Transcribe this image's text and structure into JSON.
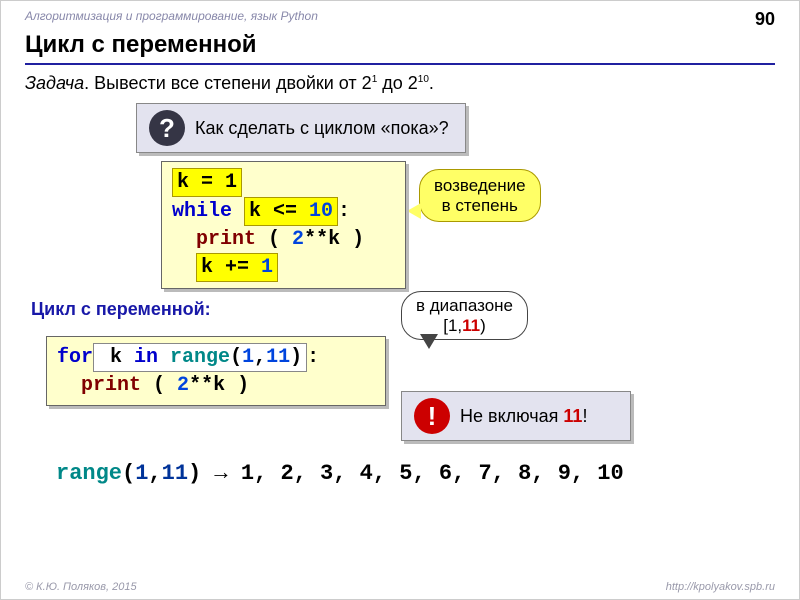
{
  "meta": {
    "header": "Алгоритмизация и программирование, язык Python",
    "page": "90",
    "footer_left": "© К.Ю. Поляков, 2015",
    "footer_right": "http://kpolyakov.spb.ru"
  },
  "title": "Цикл с переменной",
  "task": {
    "label": "Задача",
    "text": ". Вывести все степени двойки от 2",
    "sup1": "1",
    "mid": " до 2",
    "sup2": "10",
    "end": "."
  },
  "q_callout": "Как сделать с циклом «пока»?",
  "code1": {
    "l1a": "k = 1",
    "l2a": "while ",
    "l2b": "k <= ",
    "l2c": "10",
    "l3a": "print",
    "l3b": " ( ",
    "l3c": "2",
    "l3d": "**k )",
    "l4a": "k += ",
    "l4b": "1"
  },
  "bubble_pow": "возведение\nв степень",
  "subtitle": "Цикл с переменной:",
  "bubble_range": {
    "a": "в диапазоне",
    "b": "[1,",
    "c": "11",
    "d": ")"
  },
  "code2": {
    "l1a": "for",
    "l1b": " k ",
    "l1c": "in",
    "l1d": " range",
    "l1e": "(",
    "l1f": "1",
    "l1g": ",",
    "l1h": "11",
    "l1i": ")",
    "l1j": ":",
    "l2a": "print",
    "l2b": " ( ",
    "l2c": "2",
    "l2d": "**k )"
  },
  "ex_callout": {
    "a": "Не включая ",
    "b": "11",
    "c": "!"
  },
  "range_line": {
    "a": "range",
    "b": "(",
    "c": "1",
    "d": ",",
    "e": "11",
    "f": ")  →  1, 2, 3, 4, 5, 6, 7, 8, 9, 10"
  }
}
